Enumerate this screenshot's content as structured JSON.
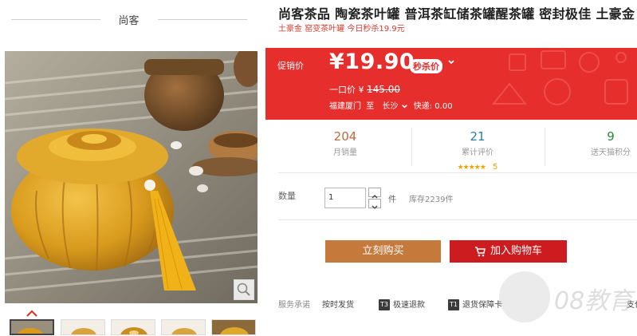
{
  "header": {
    "brand": "尚客"
  },
  "product": {
    "title": "尚客茶品 陶瓷茶叶罐 普洱茶缸储茶罐醒茶罐 密封极佳 土豪金",
    "subtitle": "土豪金 窑变茶叶罐 今日秒杀19.9元"
  },
  "price": {
    "label": "促销价",
    "value": "¥19.90",
    "badge": "秒杀价",
    "original_label": "一口价 ¥",
    "original_value": "145.00",
    "from": "福建厦门",
    "to_word": "至",
    "city": "长沙",
    "shipping": "快递: 0.00"
  },
  "stats": [
    {
      "value": "204",
      "label": "月销量",
      "color": "#c0693b"
    },
    {
      "value": "21",
      "label": "累计评价",
      "stars": "★★★★★",
      "rating": "5",
      "color": "#2a7ab3"
    },
    {
      "value": "9",
      "label": "送天猫积分",
      "color": "#2a8a3b"
    }
  ],
  "quantity": {
    "label": "数量",
    "value": "1",
    "unit": "件",
    "stock": "库存2239件"
  },
  "buttons": {
    "buy": "立刻购买",
    "cart": "加入购物车"
  },
  "service": {
    "label": "服务承诺",
    "items": [
      {
        "text": "按时发货"
      },
      {
        "icon": "T3",
        "text": "极速退款"
      },
      {
        "icon": "T1",
        "text": "退货保障卡"
      },
      {
        "text": "支付"
      }
    ]
  },
  "watermark": "08教育",
  "colors": {
    "price_red": "#e62e2c",
    "buy": "#c57a3c",
    "cart": "#cc1c1f"
  }
}
